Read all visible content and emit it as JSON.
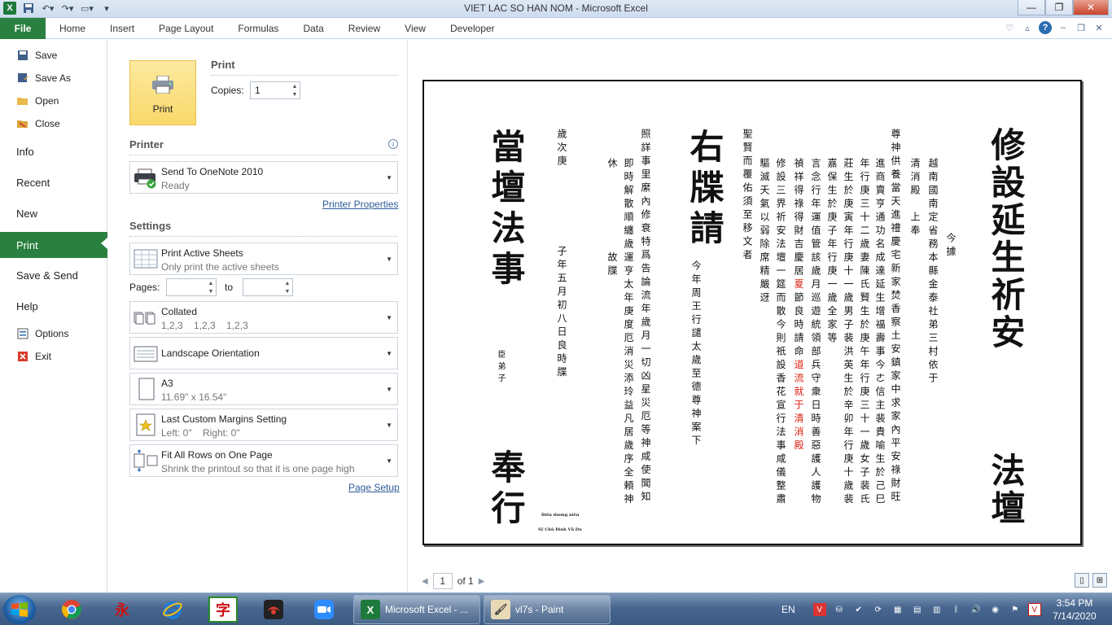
{
  "window": {
    "title": "VIET LAC SO HAN NOM  -  Microsoft Excel"
  },
  "ribbon": {
    "file_label": "File",
    "tabs": [
      "Home",
      "Insert",
      "Page Layout",
      "Formulas",
      "Data",
      "Review",
      "View",
      "Developer"
    ]
  },
  "nav": {
    "save": "Save",
    "save_as": "Save As",
    "open": "Open",
    "close": "Close",
    "info": "Info",
    "recent": "Recent",
    "new": "New",
    "print": "Print",
    "save_send": "Save & Send",
    "help": "Help",
    "options": "Options",
    "exit": "Exit"
  },
  "print": {
    "button_label": "Print",
    "section_title": "Print",
    "copies_label": "Copies:",
    "copies_value": "1"
  },
  "printer": {
    "section_title": "Printer",
    "name": "Send To OneNote 2010",
    "status": "Ready",
    "properties_link": "Printer Properties"
  },
  "settings": {
    "section_title": "Settings",
    "scope_title": "Print Active Sheets",
    "scope_desc": "Only print the active sheets",
    "pages_label": "Pages:",
    "to_label": "to",
    "pages_from": "",
    "pages_to": "",
    "collate_title": "Collated",
    "collate_desc": "1,2,3    1,2,3    1,2,3",
    "orientation": "Landscape Orientation",
    "paper_title": "A3",
    "paper_size": "11.69\" x 16.54\"",
    "margins_title": "Last Custom Margins Setting",
    "margins_desc": "Left: 0\"    Right: 0\"",
    "scaling_title": "Fit All Rows on One Page",
    "scaling_desc": "Shrink the printout so that it is one page high",
    "page_setup_link": "Page Setup"
  },
  "preview": {
    "page_current": "1",
    "page_total": "of 1",
    "title_right": "修設延生祈安",
    "bottom_right": "法壇",
    "title_mid": "右牒請",
    "title_left": "當壇法事",
    "bottom_left": "奉行",
    "col_jinju": "今據",
    "col_1": "越南國南定省務本縣金泰社弟三村依于",
    "col_2": "清消殿　上奉",
    "col_3": "尊神供養當天進禮慶宅新家焚香察土安鎮家中求家內平安祿財旺",
    "col_4": "進商賣亨通功名成達延生增福壽事今ㄜ信主裴貴喻生於己巳",
    "col_5": "年行庚三十二歲妻陳氏賢生於庚午年行庚三十一歲女子裴氏",
    "col_6": "莊生於庚寅年行庚十一歲男子裴洪英生於辛卯年行庚十歲裴",
    "col_7": "嘉保生於庚子年行庚一歲全家等",
    "col_8a": "言念行年運值管該歲月巡遊統領部兵守",
    "col_8b": "衆日時善惡護人護物",
    "col_9a": "禎祥得祿得財吉慶居",
    "col_9b": "夏",
    "col_9c": "節良時請命",
    "col_9d": "道流就于",
    "col_9e": "清消殿",
    "col_10": "修設三界祈安法壇一筵而散今則祇設香花宣行法事咸儀整肅",
    "col_11": "驅滅夭氣以弱除席精嚴迓",
    "col_12": "聖賢而覆佑須至移文者",
    "col_13": "今年周王行譴太歲至德尊神案下",
    "col_14": "照詳事里縻內修衰特爲告論流年歲月一切凶星災厄等神咸使聞知",
    "col_15": "即時解散順纏歲運亨太年庚度厄消災添玲益凡居歲序全頼神",
    "col_16": "休　　　　　　故牒",
    "col_17": "歲次庚",
    "col_18": "子年五月初八日良時牒",
    "col_19": "臣弟子",
    "sig_1": "Biên dương niên",
    "sig_2": "Sỹ Chủ Đình Vũ Du"
  },
  "taskbar": {
    "task_excel": "Microsoft Excel - ...",
    "task_paint": "vl7s - Paint",
    "lang": "EN",
    "time": "3:54 PM",
    "date": "7/14/2020",
    "pin_han1": "永",
    "pin_han2": "字"
  }
}
